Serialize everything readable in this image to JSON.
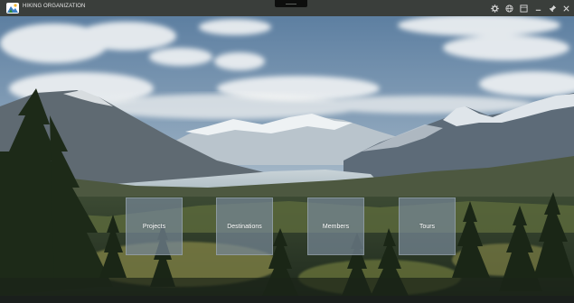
{
  "app": {
    "title": "HIKING ORGANIZATION"
  },
  "titlebar": {
    "icons": [
      "gear-icon",
      "globe-icon",
      "window-icon",
      "minimize-icon",
      "pin-icon",
      "close-icon"
    ]
  },
  "tiles": [
    {
      "label": "Projects"
    },
    {
      "label": "Destinations"
    },
    {
      "label": "Members"
    },
    {
      "label": "Tours"
    }
  ],
  "colors": {
    "titlebar": "#3a3e3b",
    "tile": "#76869680",
    "sky": "#6f8fae"
  }
}
